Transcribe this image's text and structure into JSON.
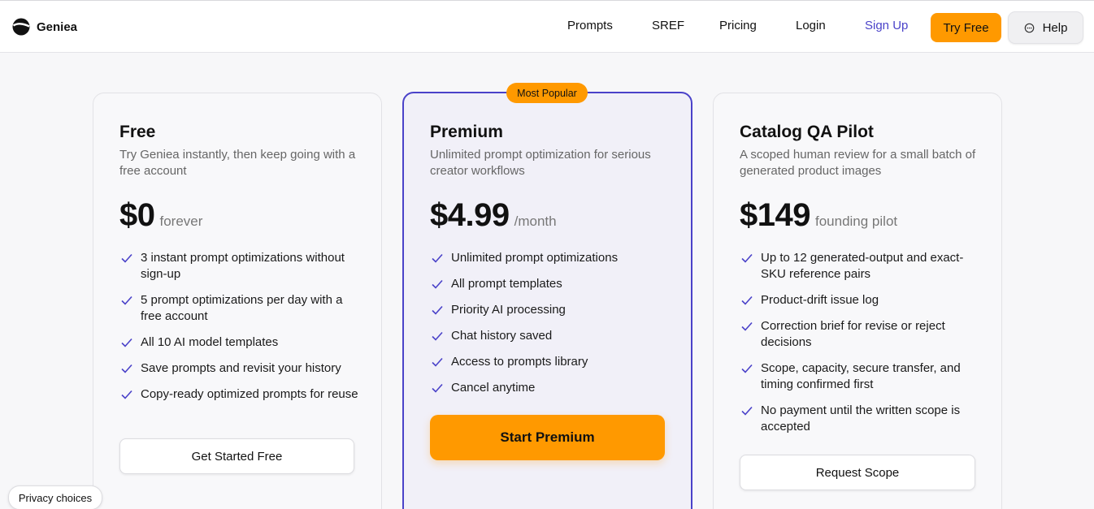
{
  "brand": {
    "name": "Geniea",
    "logo_icon": "geniea-logo-icon"
  },
  "nav": {
    "prompts": "Prompts",
    "sref": "SREF",
    "pricing": "Pricing",
    "login": "Login",
    "signup": "Sign Up",
    "try_free": "Try Free",
    "help": "Help",
    "help_icon": "chat-bubble-icon"
  },
  "colors": {
    "accent": "#ff9900",
    "brand": "#4a42c9",
    "check": "#4a42c9"
  },
  "plans": [
    {
      "title": "Free",
      "description": "Try Geniea instantly, then keep going with a free account",
      "price": "$0",
      "period": "forever",
      "features": [
        "3 instant prompt optimizations without sign-up",
        "5 prompt optimizations per day with a free account",
        "All 10 AI model templates",
        "Save prompts and revisit your history",
        "Copy-ready optimized prompts for reuse"
      ],
      "cta": "Get Started Free"
    },
    {
      "badge": "Most Popular",
      "title": "Premium",
      "description": "Unlimited prompt optimization for serious creator workflows",
      "price": "$4.99",
      "period": "/month",
      "features": [
        "Unlimited prompt optimizations",
        "All prompt templates",
        "Priority AI processing",
        "Chat history saved",
        "Access to prompts library",
        "Cancel anytime"
      ],
      "cta": "Start Premium"
    },
    {
      "title": "Catalog QA Pilot",
      "description": "A scoped human review for a small batch of generated product images",
      "price": "$149",
      "period": "founding pilot",
      "features": [
        "Up to 12 generated-output and exact-SKU reference pairs",
        "Product-drift issue log",
        "Correction brief for revise or reject decisions",
        "Scope, capacity, secure transfer, and timing confirmed first",
        "No payment until the written scope is accepted"
      ],
      "cta": "Request Scope"
    }
  ],
  "privacy": {
    "label": "Privacy choices"
  }
}
